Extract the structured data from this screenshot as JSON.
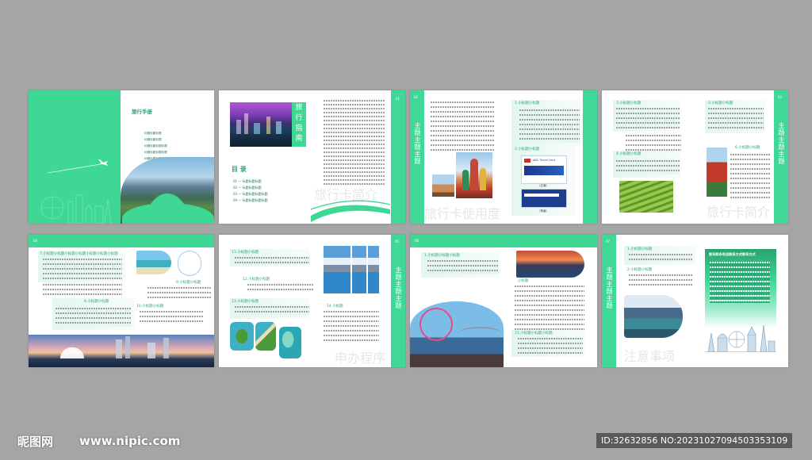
{
  "cover": {
    "title": "旅行手册",
    "items": [
      "标题标题标题",
      "标题标题标题",
      "标题标题标题标题",
      "标题标题标题标题",
      "标题标题标题标题"
    ]
  },
  "p2": {
    "title_chars": [
      "旅",
      "行",
      "指",
      "南"
    ],
    "toc_title": "目 录",
    "toc": [
      "01 — 标题标题标题",
      "02 — 标题标题标题",
      "03 — 标题标题标题标题",
      "04 — 标题标题标题标题"
    ],
    "watermark": "旅行卡简介",
    "page_no": "01"
  },
  "p3": {
    "heading1": "1.小标题小标题",
    "heading2": "2.小标题小标题",
    "vtext": "主题主题主题",
    "watermark": "旅行卡使用度",
    "page_no": "02",
    "card_label_1": "（正面）",
    "card_label_2": "（背面）",
    "card_brand": "ABC Travel Card"
  },
  "p4": {
    "heading1": "3.小标题小标题",
    "heading2": "4.小标题小标题",
    "heading3": "5.小标题小标题",
    "heading4": "6.小标题小标题",
    "vtext": "主题主题主题",
    "watermark": "旅行卡简介",
    "page_no": "03"
  },
  "p5": {
    "heading1": "7.小标题小标题小标题小标题小标题小标题小标题",
    "heading2": "8.小标题小标题",
    "heading3": "9.小标题小标题",
    "heading4": "10.小标题小标题",
    "page_no": "04"
  },
  "p6": {
    "heading1": "11.小标题小标题",
    "heading2": "12.小标题小标题",
    "heading3": "13.小标题小标题",
    "heading4": "14.小标题",
    "vtext": "主题主题主题",
    "watermark": "申办程序",
    "page_no": "05"
  },
  "p7": {
    "heading1": "1.小标题小标题小标题",
    "heading2": "小标题",
    "heading3": "15.小标题小标题小标题",
    "page_no": "06"
  },
  "p8": {
    "heading1": "1.小标题小标题",
    "heading2": "2.小标题小标题",
    "panel_title": "联系联系电话联系方式联系方式",
    "vtext": "主题主题主题",
    "watermark": "注意事项",
    "page_no": "07"
  },
  "watermark": {
    "logo": "昵图网",
    "url": "www.nipic.com",
    "id": "ID:32632856 NO:20231027094503353109"
  }
}
